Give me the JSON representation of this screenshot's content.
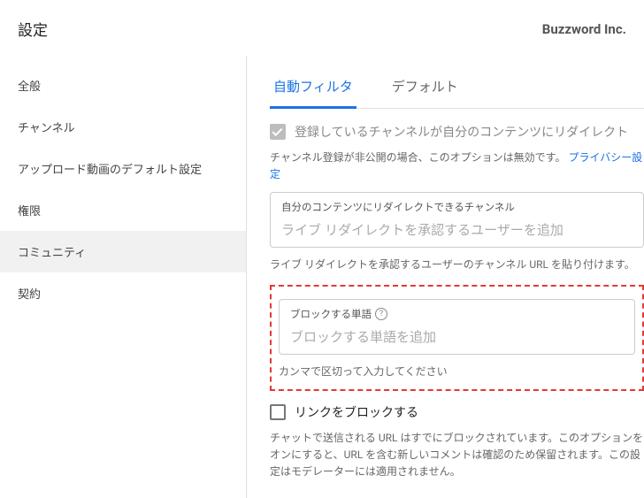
{
  "header": {
    "title": "設定",
    "brand": "Buzzword Inc."
  },
  "sidebar": {
    "items": [
      {
        "label": "全般"
      },
      {
        "label": "チャンネル"
      },
      {
        "label": "アップロード動画のデフォルト設定"
      },
      {
        "label": "権限"
      },
      {
        "label": "コミュニティ"
      },
      {
        "label": "契約"
      }
    ]
  },
  "tabs": [
    {
      "label": "自動フィルタ"
    },
    {
      "label": "デフォルト"
    }
  ],
  "main": {
    "redirect": {
      "checkbox_label": "登録しているチャンネルが自分のコンテンツにリダイレクト",
      "help_prefix": "チャンネル登録が非公開の場合、このオプションは無効です。",
      "help_link": "プライバシー設定",
      "box_label": "自分のコンテンツにリダイレクトできるチャンネル",
      "box_placeholder": "ライブ リダイレクトを承認するユーザーを追加",
      "help_below": "ライブ リダイレクトを承認するユーザーのチャンネル URL を貼り付けます。"
    },
    "blocked_words": {
      "box_label": "ブロックする単語",
      "help_icon_char": "?",
      "box_placeholder": "ブロックする単語を追加",
      "help_below": "カンマで区切って入力してください"
    },
    "block_links": {
      "checkbox_label": "リンクをブロックする",
      "help": "チャットで送信される URL はすでにブロックされています。このオプションをオンにすると、URL を含む新しいコメントは確認のため保留されます。この設定はモデレーターには適用されません。"
    }
  }
}
